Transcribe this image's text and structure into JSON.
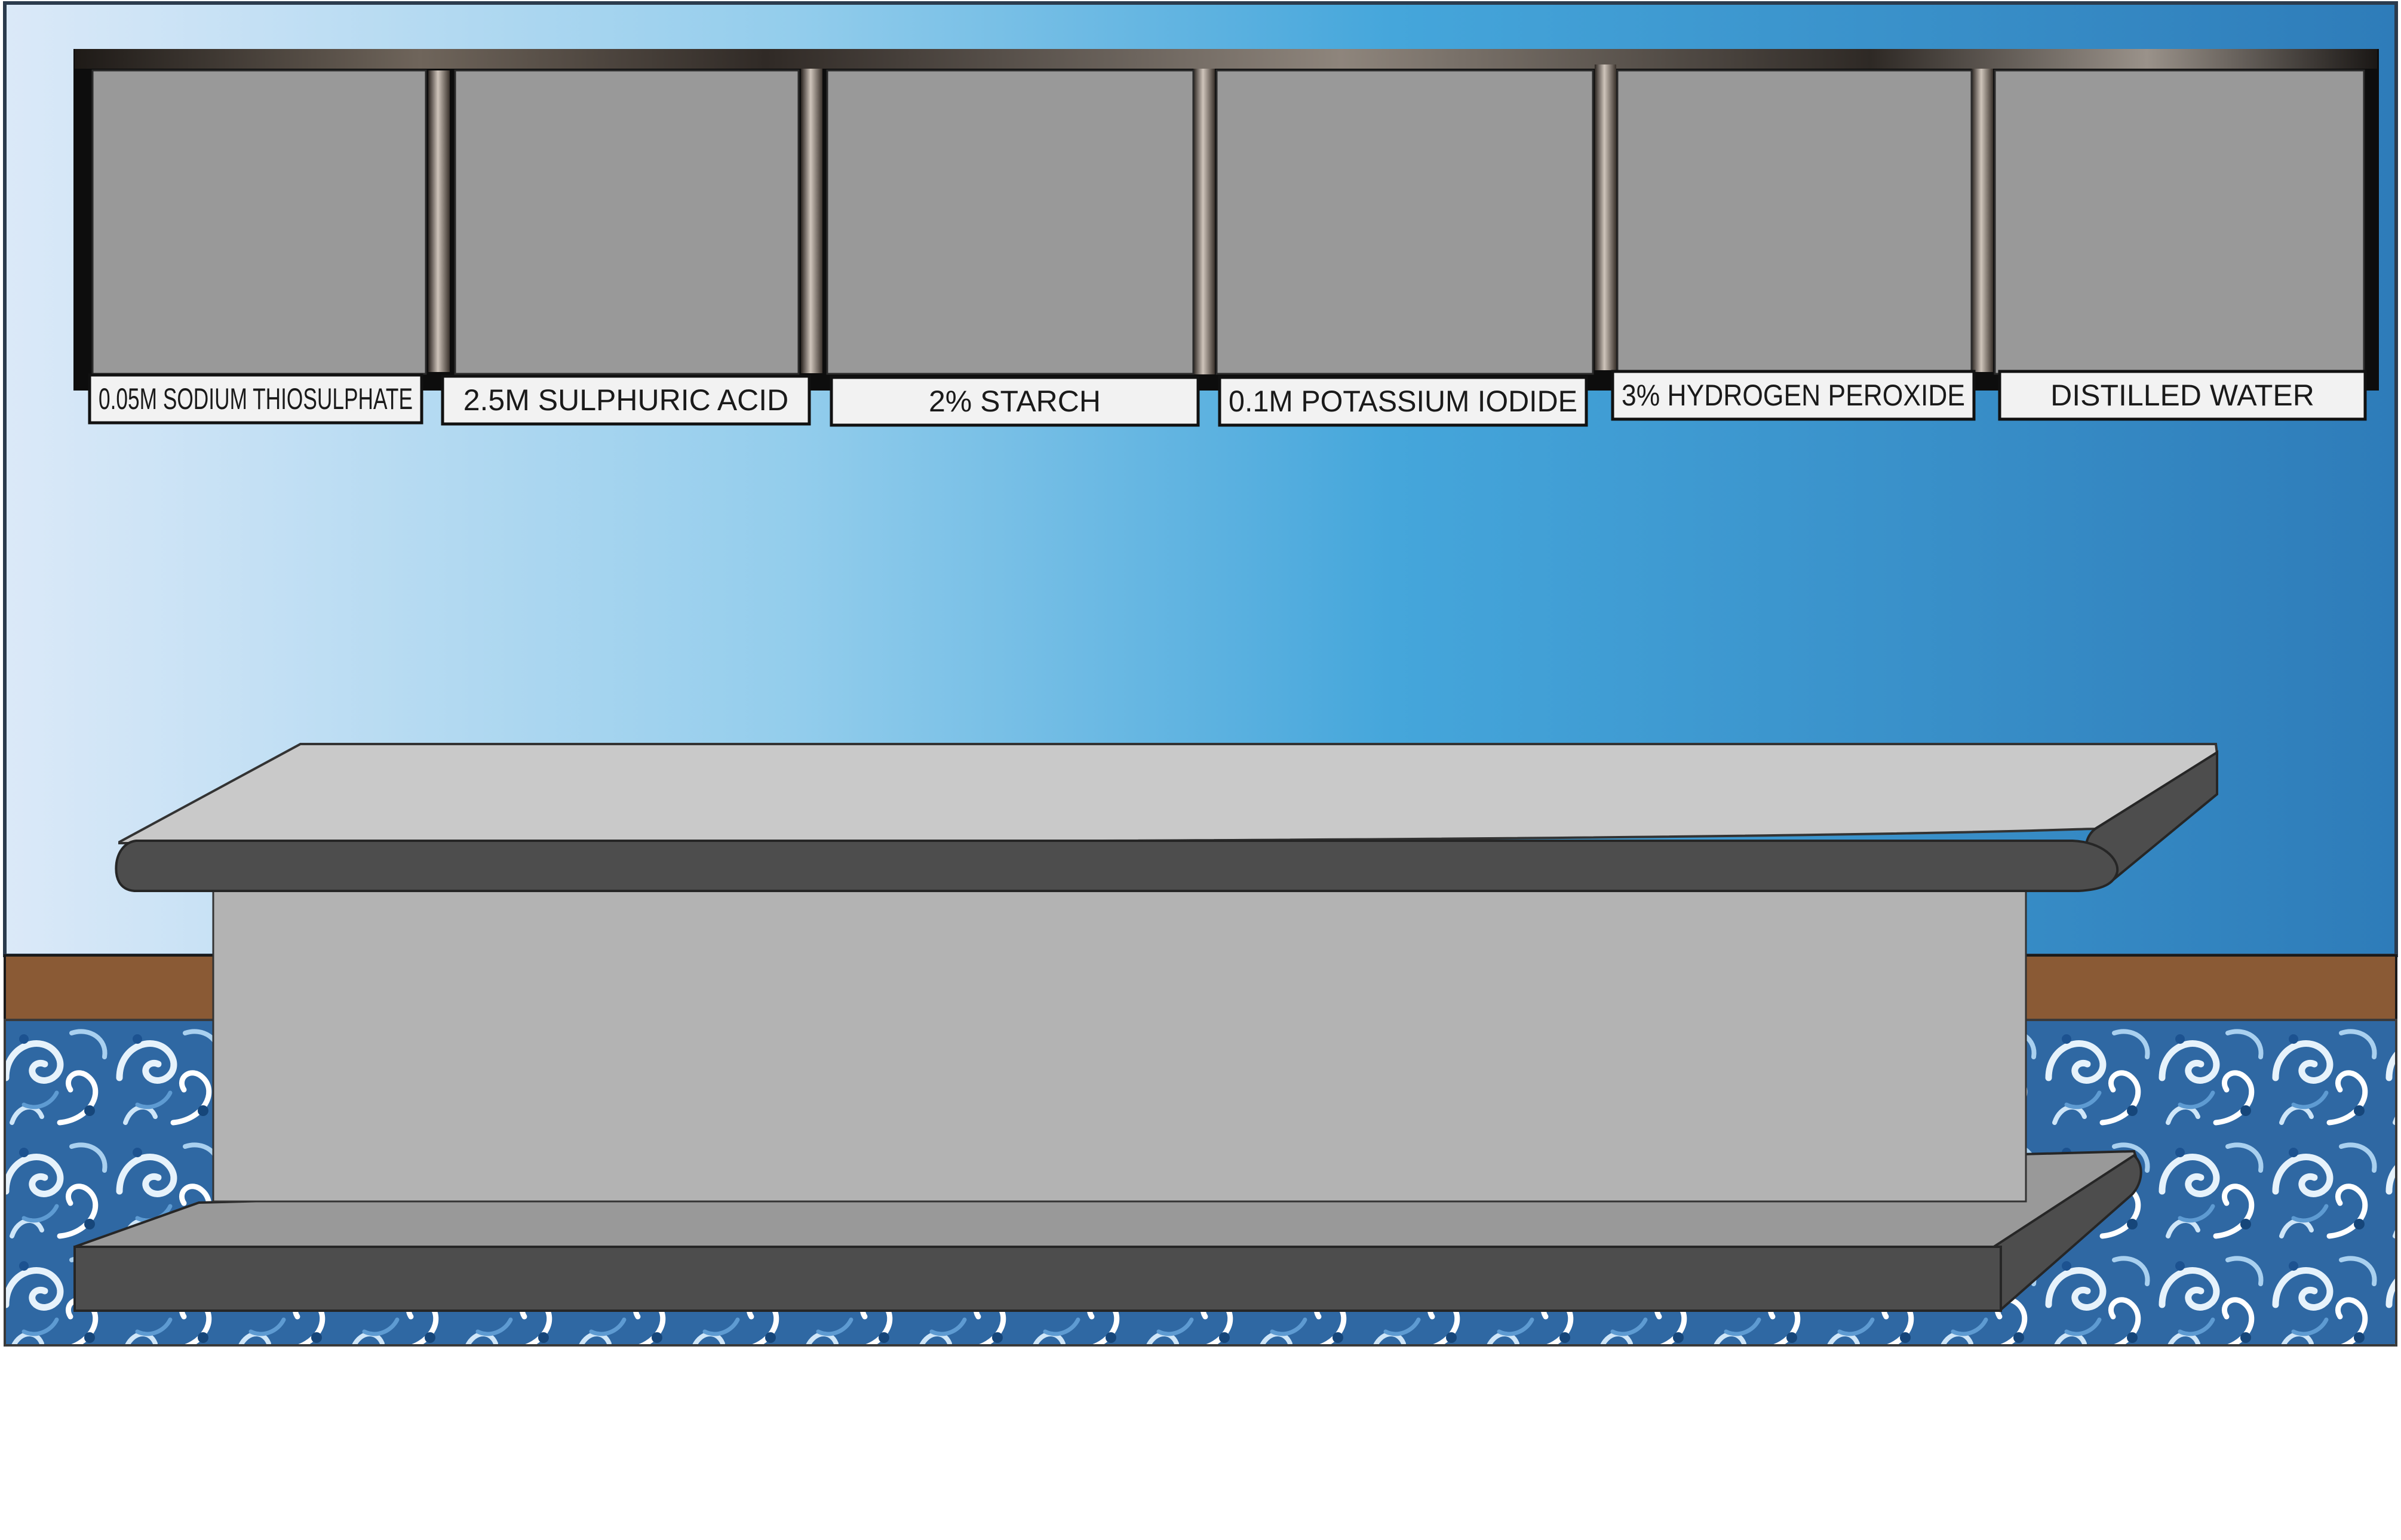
{
  "shelf": {
    "bottles": [
      {
        "label": "0.05M SODIUM THIOSULPHATE",
        "name": "sodium-thiosulphate-bottle"
      },
      {
        "label": "2.5M SULPHURIC ACID",
        "name": "sulphuric-acid-bottle"
      },
      {
        "label": "2% STARCH",
        "name": "starch-bottle"
      },
      {
        "label": "0.1M POTASSIUM IODIDE",
        "name": "potassium-iodide-bottle"
      },
      {
        "label": "3% HYDROGEN PEROXIDE",
        "name": "hydrogen-peroxide-bottle"
      },
      {
        "label": "DISTILLED WATER",
        "name": "distilled-water-bottle"
      }
    ]
  },
  "colors": {
    "wall_gradient": [
      "#dbe9f8",
      "#8ccaeb",
      "#3d9fd8",
      "#2f7fbf"
    ],
    "shelf_frame": "#111111",
    "bottle": "#999999",
    "label_bg": "#f2f2f2",
    "skirting": "#8a5a35",
    "floor_tile": "#2d6aa8",
    "bench_top": "#c9c9c9",
    "bench_edge": "#4d4d4d",
    "bench_body": "#b3b3b3"
  }
}
